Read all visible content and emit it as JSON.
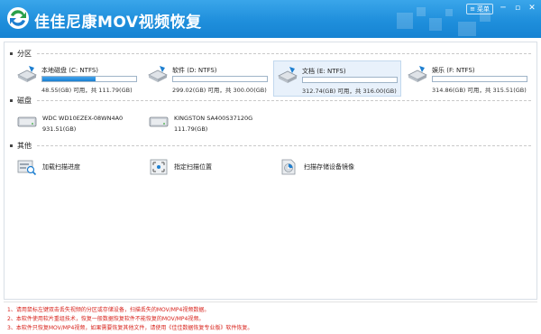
{
  "app": {
    "title": "佳佳尼康MOV视频恢复",
    "menu_label": "菜单",
    "minimize_glyph": "─",
    "maximize_glyph": "▫",
    "close_glyph": "✕"
  },
  "sections": {
    "partitions": "分区",
    "disks": "磁盘",
    "others": "其他"
  },
  "partitions": [
    {
      "name": "本地磁盘 (C: NTFS)",
      "capacity": "48.55(GB) 可用，共 111.79(GB)",
      "used_fraction": 0.57,
      "selected": false
    },
    {
      "name": "软件 (D: NTFS)",
      "capacity": "299.02(GB) 可用，共 300.00(GB)",
      "used_fraction": 0.0,
      "selected": false
    },
    {
      "name": "文档 (E: NTFS)",
      "capacity": "312.74(GB) 可用，共 316.00(GB)",
      "used_fraction": 0.0,
      "selected": true
    },
    {
      "name": "娱乐 (F: NTFS)",
      "capacity": "314.86(GB) 可用，共 315.51(GB)",
      "used_fraction": 0.0,
      "selected": false
    }
  ],
  "disks": [
    {
      "name": "WDC WD10EZEX-08WN4A0",
      "size": "931.51(GB)"
    },
    {
      "name": "KINGSTON SA400S37120G",
      "size": "111.79(GB)"
    }
  ],
  "tools": [
    {
      "label": "加载扫描进度",
      "icon": "load-progress-icon"
    },
    {
      "label": "指定扫描位置",
      "icon": "scan-location-icon"
    },
    {
      "label": "扫描存储设备镜像",
      "icon": "disk-image-icon"
    }
  ],
  "notes": [
    "1、请用鼠标左键双击丢失视频的分区或存储设备，扫描丢失的MOV/MP4视频数据。",
    "2、本软件使用软片重组技术，恢复一般数据恢复软件不能恢复的MOV/MP4视频。",
    "3、本软件只恢复MOV/MP4视频，如果需要恢复其他文件，请使用《佳佳数据恢复专业版》软件恢复。"
  ],
  "colors": {
    "titlebar": "#1f8fdc",
    "accent": "#1a7fd0",
    "note_red": "#d8231c",
    "selected_bg": "#e8f1fb"
  }
}
